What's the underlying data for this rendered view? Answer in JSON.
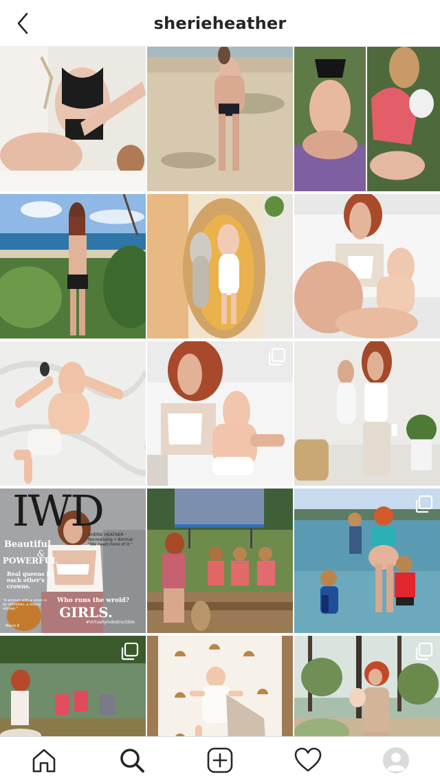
{
  "header": {
    "username": "sherieheather",
    "back_icon": "chevron-left-icon"
  },
  "cover": {
    "title": "IWD",
    "subtitle": "SHERIE HEATHER · Normalising • Normal · \"We need more of it.\"",
    "beautiful": "Beautiful",
    "amp": "&",
    "powerful": "POWERFUL",
    "queens": "Real queens fix each other's crowns.",
    "quote": "\"A woman with a vision is by definition, a strong woman.\"",
    "who": "Who runs the wrold?",
    "girls": "GIRLS.",
    "hashtag": "#VirtuallyIndestructible",
    "date": "March 8"
  },
  "colors": {
    "accent": "#262626",
    "divider": "#dbdbdb"
  },
  "nav": {
    "items": [
      "home-icon",
      "search-icon",
      "new-post-icon",
      "activity-heart-icon",
      "profile-avatar"
    ]
  }
}
